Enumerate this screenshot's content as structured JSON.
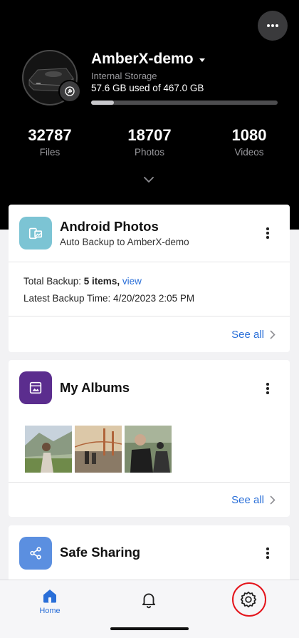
{
  "device": {
    "name": "AmberX-demo",
    "storage_label": "Internal Storage",
    "storage_usage": "57.6 GB used of 467.0 GB",
    "storage_used_fraction": 0.123
  },
  "stats": [
    {
      "value": "32787",
      "label": "Files"
    },
    {
      "value": "18707",
      "label": "Photos"
    },
    {
      "value": "1080",
      "label": "Videos"
    }
  ],
  "android_photos": {
    "title": "Android Photos",
    "subtitle": "Auto Backup to AmberX-demo",
    "total_label": "Total Backup: ",
    "total_value": "5 items,",
    "view_link": "view",
    "latest_backup": "Latest Backup Time: 4/20/2023 2:05 PM",
    "see_all": "See all"
  },
  "my_albums": {
    "title": "My Albums",
    "see_all": "See all"
  },
  "safe_sharing": {
    "title": "Safe Sharing"
  },
  "bottom_nav": {
    "home_label": "Home"
  },
  "colors": {
    "accent": "#2a6fd8",
    "android_icon_bg": "#7cc4d4",
    "albums_icon_bg": "#5b2d8e",
    "sharing_icon_bg": "#5b8fe0",
    "highlight_ring": "#e4141b"
  },
  "icons": {
    "header_menu": "more-horizontal-icon",
    "device_badge": "wrench-icon",
    "android_photos": "phone-gallery-icon",
    "my_albums": "album-icon",
    "safe_sharing": "share-icon",
    "home": "home-icon",
    "notifications": "bell-icon",
    "settings": "gear-icon"
  }
}
